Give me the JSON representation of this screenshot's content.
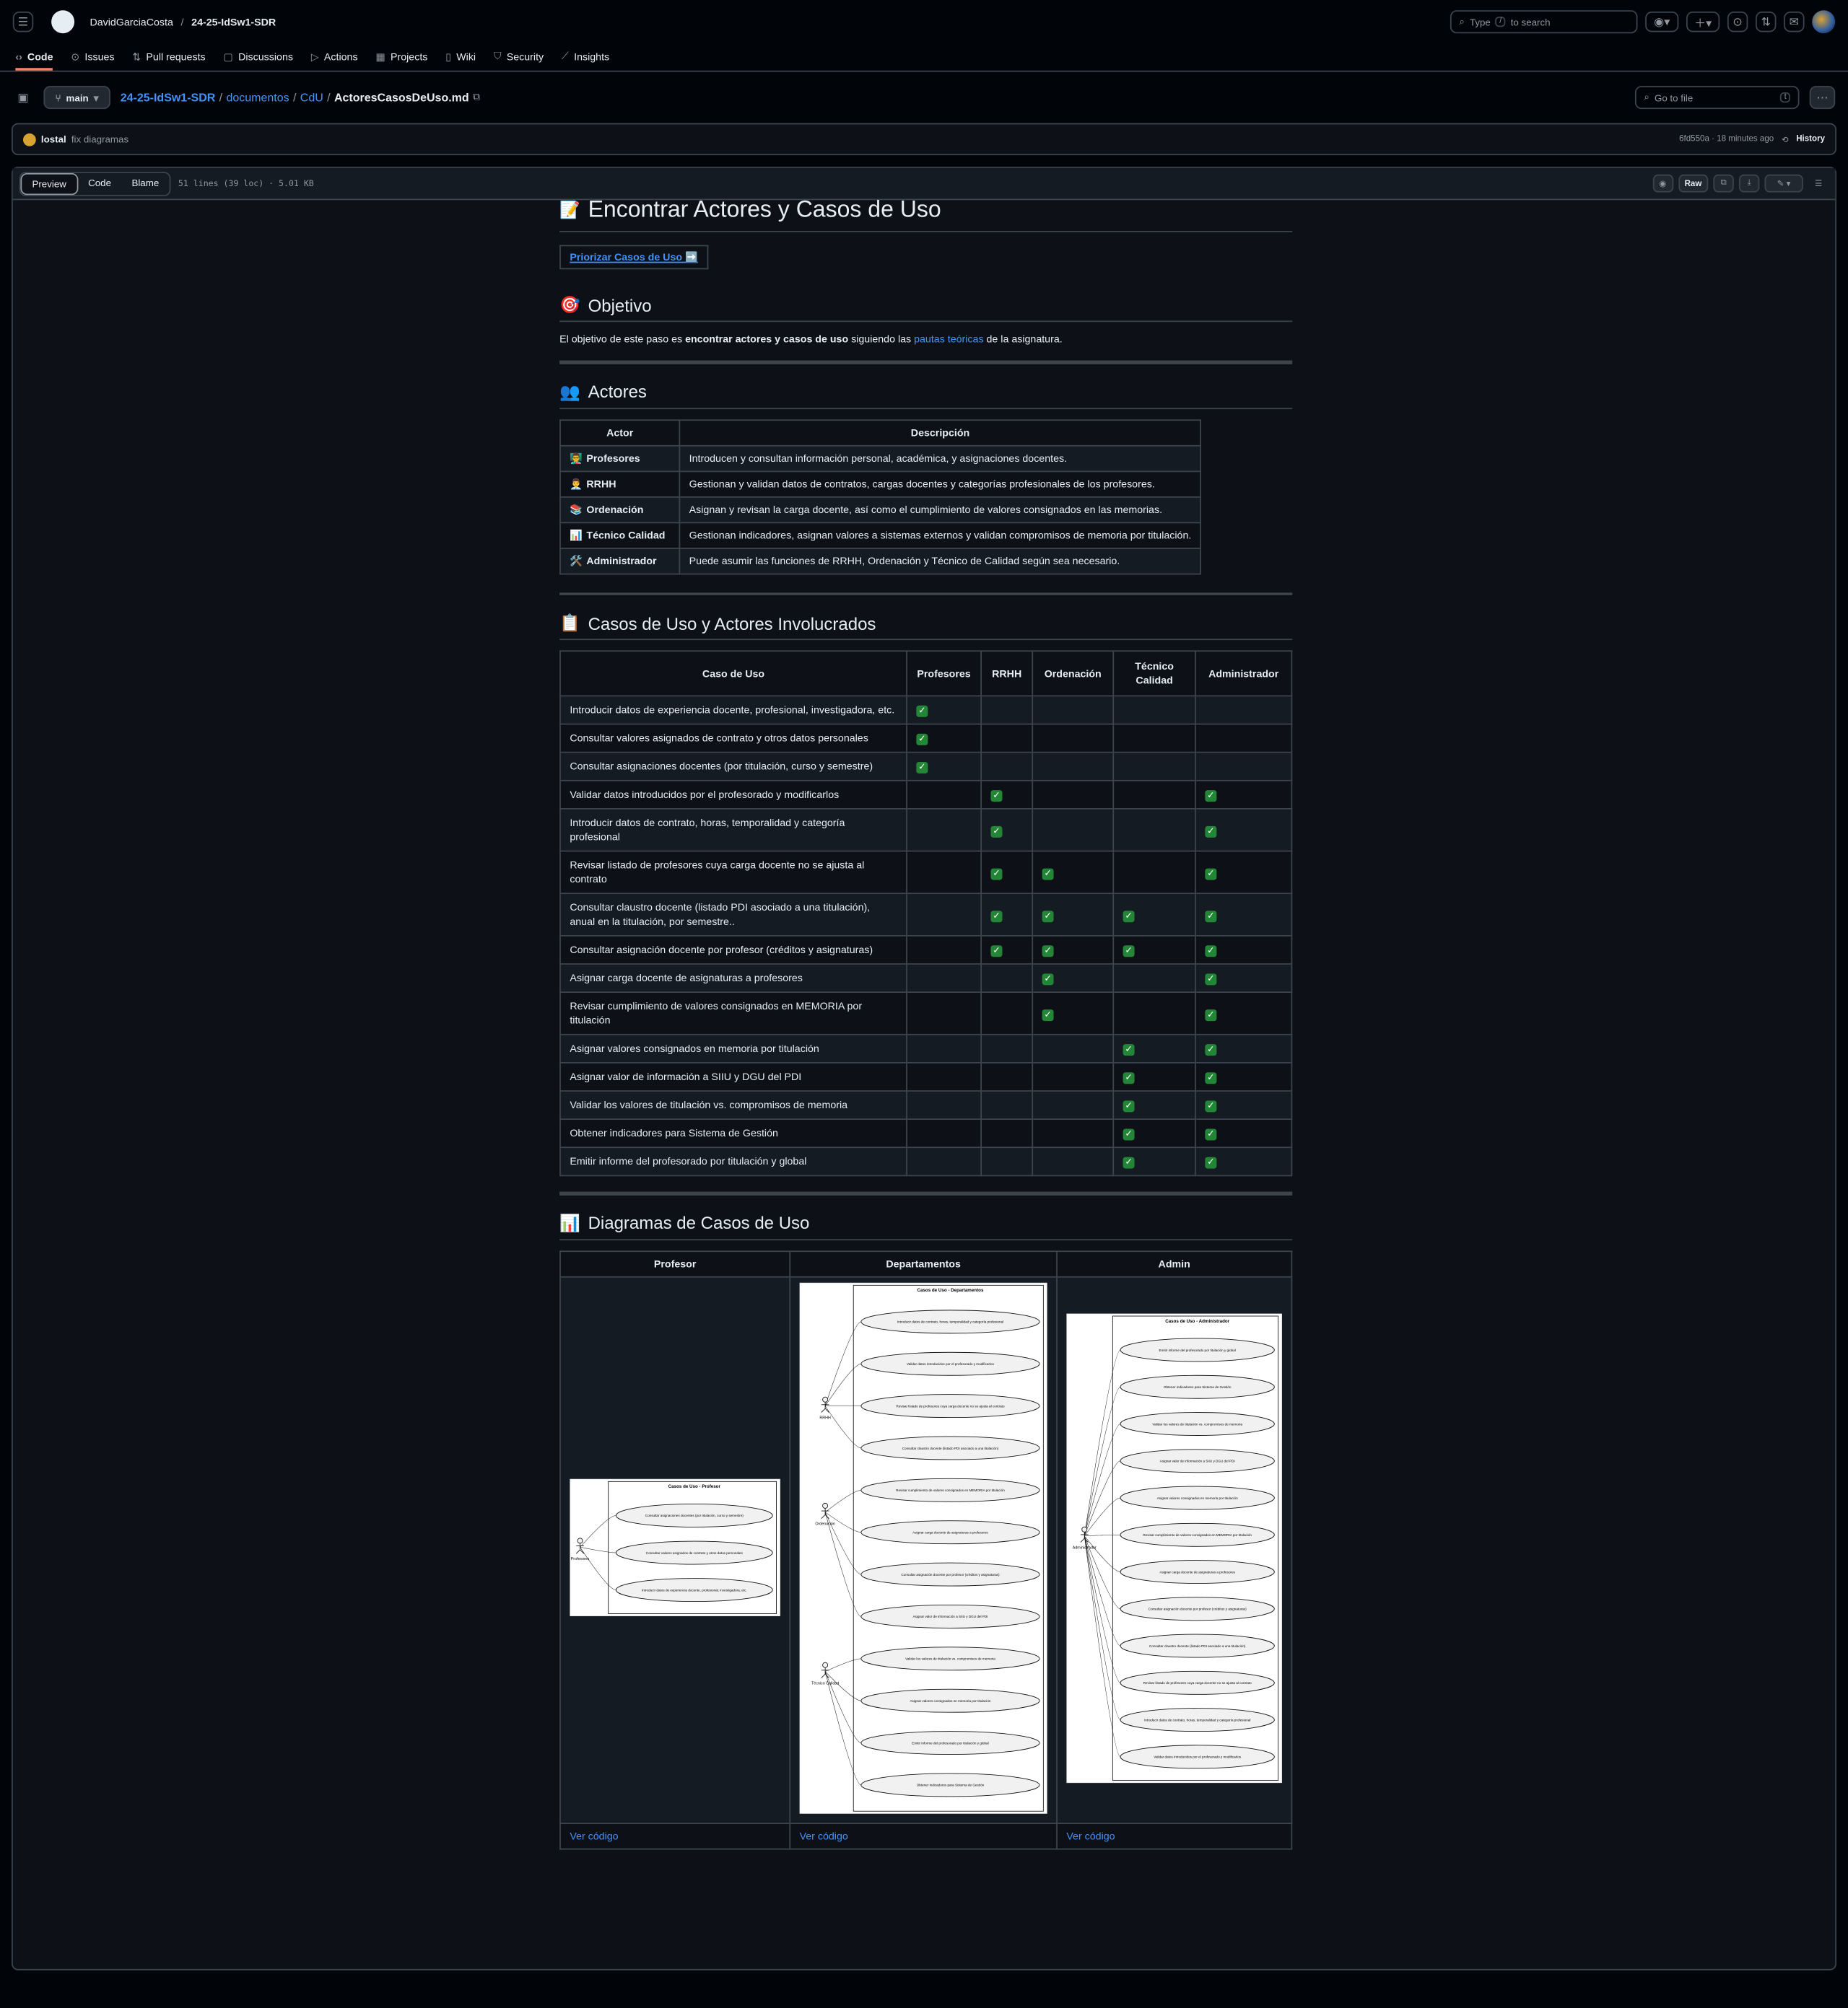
{
  "header": {
    "owner": "DavidGarciaCosta",
    "repo": "24-25-IdSw1-SDR",
    "search_placeholder_pre": "Type",
    "search_key": "/",
    "search_placeholder_post": "to search"
  },
  "nav": {
    "tabs": [
      {
        "label": "Code",
        "icon": "code-icon"
      },
      {
        "label": "Issues",
        "icon": "issue-icon"
      },
      {
        "label": "Pull requests",
        "icon": "pull-request-icon"
      },
      {
        "label": "Discussions",
        "icon": "discussion-icon"
      },
      {
        "label": "Actions",
        "icon": "play-icon"
      },
      {
        "label": "Projects",
        "icon": "table-icon"
      },
      {
        "label": "Wiki",
        "icon": "book-icon"
      },
      {
        "label": "Security",
        "icon": "shield-icon"
      },
      {
        "label": "Insights",
        "icon": "graph-icon"
      }
    ]
  },
  "filebar": {
    "branch": "main",
    "path": [
      "24-25-IdSw1-SDR",
      "documentos",
      "CdU"
    ],
    "file": "ActoresCasosDeUso.md",
    "goto_placeholder": "Go to file",
    "goto_key": "t"
  },
  "commit": {
    "author": "lostal",
    "message": "fix diagramas",
    "hash_time": "6fd550a · 18 minutes ago",
    "history": "History"
  },
  "file": {
    "views": [
      "Preview",
      "Code",
      "Blame"
    ],
    "meta": "51 lines (39 loc) · 5.01 KB",
    "raw": "Raw"
  },
  "doc": {
    "title": "Encontrar Actores y Casos de Uso",
    "title_emoji": "📝",
    "nav_link": "Priorizar Casos de Uso ➡️",
    "objetivo_h": "Objetivo",
    "objetivo_emoji": "🎯",
    "objetivo_pre": "El objetivo de este paso es ",
    "objetivo_bold": "encontrar actores y casos de uso",
    "objetivo_mid": " siguiendo las ",
    "objetivo_link": "pautas teóricas",
    "objetivo_post": " de la asignatura.",
    "actores_h": "Actores",
    "actores_emoji": "👥",
    "actores_cols": [
      "Actor",
      "Descripción"
    ],
    "actores": [
      {
        "emoji": "👨‍🏫",
        "name": "Profesores",
        "desc": "Introducen y consultan información personal, académica, y asignaciones docentes."
      },
      {
        "emoji": "👨‍💼",
        "name": "RRHH",
        "desc": "Gestionan y validan datos de contratos, cargas docentes y categorías profesionales de los profesores."
      },
      {
        "emoji": "📚",
        "name": "Ordenación",
        "desc": "Asignan y revisan la carga docente, así como el cumplimiento de valores consignados en las memorias."
      },
      {
        "emoji": "📊",
        "name": "Técnico Calidad",
        "desc": "Gestionan indicadores, asignan valores a sistemas externos y validan compromisos de memoria por titulación."
      },
      {
        "emoji": "🛠️",
        "name": "Administrador",
        "desc": "Puede asumir las funciones de RRHH, Ordenación y Técnico de Calidad según sea necesario."
      }
    ],
    "casos_h": "Casos de Uso y Actores Involucrados",
    "casos_emoji": "📋",
    "casos_cols": [
      "Caso de Uso",
      "Profesores",
      "RRHH",
      "Ordenación",
      "Técnico Calidad",
      "Administrador"
    ],
    "casos": [
      {
        "name": "Introducir datos de experiencia docente, profesional, investigadora, etc.",
        "marks": [
          1,
          0,
          0,
          0,
          0
        ]
      },
      {
        "name": "Consultar valores asignados de contrato y otros datos personales",
        "marks": [
          1,
          0,
          0,
          0,
          0
        ]
      },
      {
        "name": "Consultar asignaciones docentes (por titulación, curso y semestre)",
        "marks": [
          1,
          0,
          0,
          0,
          0
        ]
      },
      {
        "name": "Validar datos introducidos por el profesorado y modificarlos",
        "marks": [
          0,
          1,
          0,
          0,
          1
        ]
      },
      {
        "name": "Introducir datos de contrato, horas, temporalidad y categoría profesional",
        "marks": [
          0,
          1,
          0,
          0,
          1
        ]
      },
      {
        "name": "Revisar listado de profesores cuya carga docente no se ajusta al contrato",
        "marks": [
          0,
          1,
          1,
          0,
          1
        ]
      },
      {
        "name": "Consultar claustro docente (listado PDI asociado a una titulación), anual en la titulación, por semestre..",
        "marks": [
          0,
          1,
          1,
          1,
          1
        ]
      },
      {
        "name": "Consultar asignación docente por profesor (créditos y asignaturas)",
        "marks": [
          0,
          1,
          1,
          1,
          1
        ]
      },
      {
        "name": "Asignar carga docente de asignaturas a profesores",
        "marks": [
          0,
          0,
          1,
          0,
          1
        ]
      },
      {
        "name": "Revisar cumplimiento de valores consignados en MEMORIA por titulación",
        "marks": [
          0,
          0,
          1,
          0,
          1
        ]
      },
      {
        "name": "Asignar valores consignados en memoria por titulación",
        "marks": [
          0,
          0,
          0,
          1,
          1
        ]
      },
      {
        "name": "Asignar valor de información a SIIU y DGU del PDI",
        "marks": [
          0,
          0,
          0,
          1,
          1
        ]
      },
      {
        "name": "Validar los valores de titulación vs. compromisos de memoria",
        "marks": [
          0,
          0,
          0,
          1,
          1
        ]
      },
      {
        "name": "Obtener indicadores para Sistema de Gestión",
        "marks": [
          0,
          0,
          0,
          1,
          1
        ]
      },
      {
        "name": "Emitir informe del profesorado por titulación y global",
        "marks": [
          0,
          0,
          0,
          1,
          1
        ]
      }
    ],
    "check": "✓",
    "diag_h": "Diagramas de Casos de Uso",
    "diag_emoji": "📊",
    "diag_cols": [
      "Profesor",
      "Departamentos",
      "Admin"
    ],
    "diag_link": "Ver código",
    "diagrams": {
      "profesor": {
        "title": "Casos de Uso - Profesor",
        "actors": [
          "Profesores"
        ],
        "cases": [
          "Consultar asignaciones docentes (por titulación, curso y semestre)",
          "Consultar valores asignados de contrato y otros datos personales",
          "Introducir datos de experiencia docente, profesional, investigadora, etc."
        ]
      },
      "departamentos": {
        "title": "Casos de Uso - Departamentos",
        "actors": [
          "RRHH",
          "Ordenación",
          "Técnico Calidad"
        ],
        "cases": [
          "Introducir datos de contrato, horas, temporalidad y categoría profesional",
          "Validar datos introducidos por el profesorado y modificarlos",
          "Revisar listado de profesores cuya carga docente no se ajusta al contrato",
          "Consultar claustro docente (listado PDI asociado a una titulación)",
          "Revisar cumplimiento de valores consignados en MEMORIA por titulación",
          "Asignar carga docente de asignaturas a profesores",
          "Consultar asignación docente por profesor (créditos y asignaturas)",
          "Asignar valor de información a SIIU y DGU del PDI",
          "Validar los valores de titulación vs. compromisos de memoria",
          "Asignar valores consignados en memoria por titulación",
          "Emitir informe del profesorado por titulación y global",
          "Obtener indicadores para Sistema de Gestión"
        ]
      },
      "admin": {
        "title": "Casos de Uso - Administrador",
        "actors": [
          "Administrador"
        ],
        "cases": [
          "Emitir informe del profesorado por titulación y global",
          "Obtener indicadores para Sistema de Gestión",
          "Validar los valores de titulación vs. compromisos de memoria",
          "Asignar valor de información a SIIU y DGU del PDI",
          "Asignar valores consignados en memoria por titulación",
          "Revisar cumplimiento de valores consignados en MEMORIA por titulación",
          "Asignar carga docente de asignaturas a profesores",
          "Consultar asignación docente por profesor (créditos y asignaturas)",
          "Consultar claustro docente (listado PDI asociado a una titulación)",
          "Revisar listado de profesores cuya carga docente no se ajusta al contrato",
          "Introducir datos de contrato, horas, temporalidad y categoría profesional",
          "Validar datos introducidos por el profesorado y modificarlos"
        ]
      }
    }
  }
}
